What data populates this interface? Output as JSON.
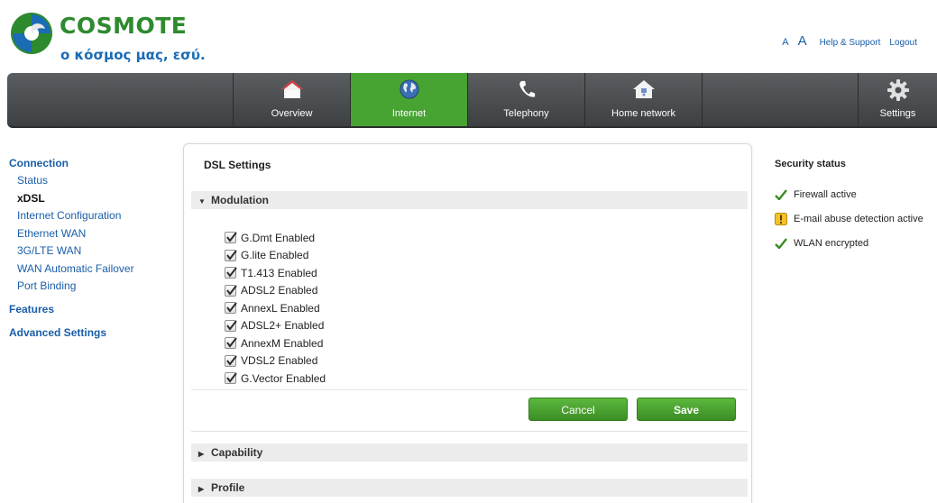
{
  "brand": {
    "name": "COSMOTE",
    "tagline": "ο κόσμος μας, εσύ."
  },
  "top_links": {
    "font_small": "A",
    "font_large": "A",
    "help": "Help & Support",
    "logout": "Logout"
  },
  "nav": {
    "items": [
      {
        "label": "Overview",
        "icon": "house-icon"
      },
      {
        "label": "Internet",
        "icon": "globe-icon",
        "active": true
      },
      {
        "label": "Telephony",
        "icon": "phone-icon"
      },
      {
        "label": "Home network",
        "icon": "home-network-icon"
      }
    ],
    "settings": {
      "label": "Settings",
      "icon": "gear-icon"
    }
  },
  "sidebar": {
    "connection": "Connection",
    "items": [
      "Status",
      "xDSL",
      "Internet Configuration",
      "Ethernet WAN",
      "3G/LTE WAN",
      "WAN Automatic Failover",
      "Port Binding"
    ],
    "current": "xDSL",
    "features": "Features",
    "advanced": "Advanced Settings"
  },
  "panel": {
    "title": "DSL Settings",
    "modulation_label": "Modulation",
    "options": [
      {
        "label": "G.Dmt Enabled",
        "checked": true
      },
      {
        "label": "G.lite Enabled",
        "checked": true
      },
      {
        "label": "T1.413 Enabled",
        "checked": true
      },
      {
        "label": "ADSL2 Enabled",
        "checked": true
      },
      {
        "label": "AnnexL Enabled",
        "checked": true
      },
      {
        "label": "ADSL2+ Enabled",
        "checked": true
      },
      {
        "label": "AnnexM Enabled",
        "checked": true
      },
      {
        "label": "VDSL2 Enabled",
        "checked": true
      },
      {
        "label": "G.Vector Enabled",
        "checked": true
      }
    ],
    "cancel": "Cancel",
    "save": "Save",
    "capability_label": "Capability",
    "profile_label": "Profile"
  },
  "security": {
    "title": "Security status",
    "items": [
      {
        "label": "Firewall active",
        "icon": "check-icon"
      },
      {
        "label": "E-mail abuse detection active",
        "icon": "warning-icon"
      },
      {
        "label": "WLAN encrypted",
        "icon": "check-icon"
      }
    ]
  },
  "colors": {
    "accent_green": "#47a332",
    "link_blue": "#1a5ea8",
    "nav_dark": "#4a4d50"
  }
}
